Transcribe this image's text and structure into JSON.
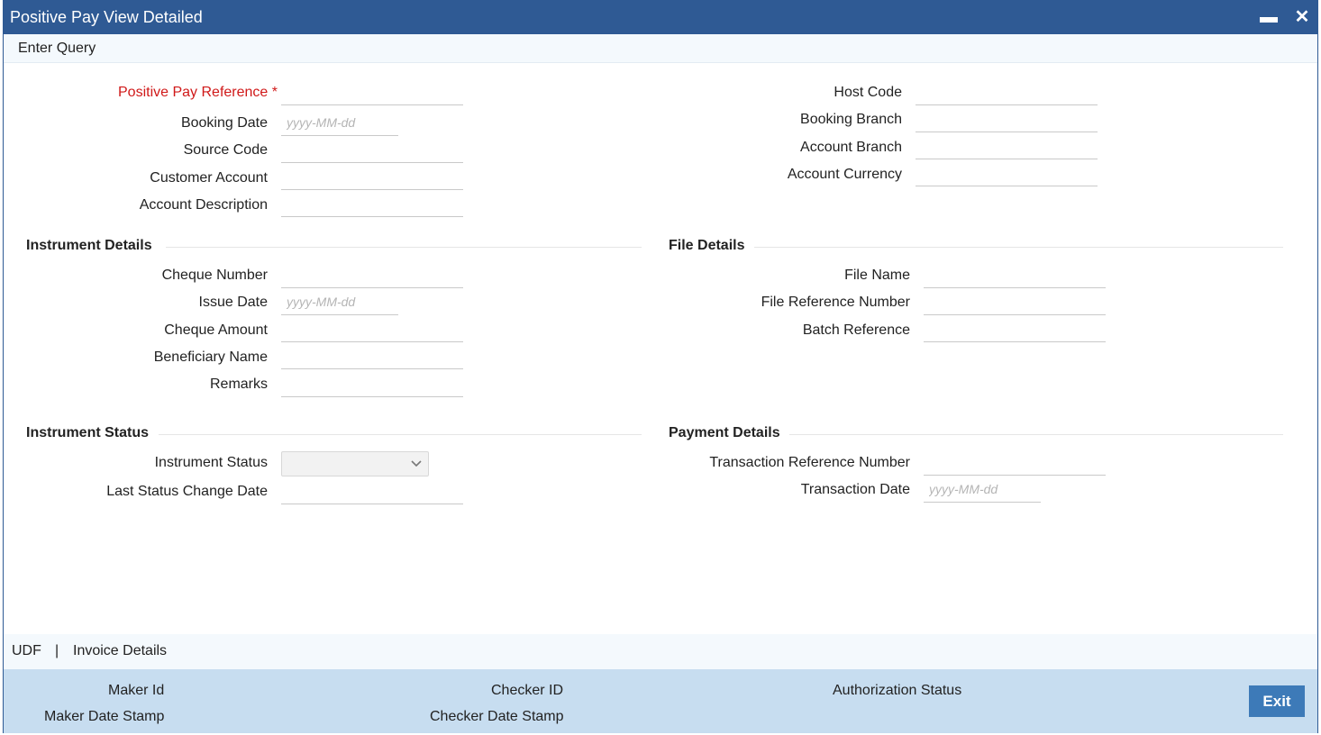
{
  "window": {
    "title": "Positive Pay View Detailed",
    "minimize_glyph": "▬",
    "close_glyph": "✕"
  },
  "menu": {
    "enter_query": "Enter Query"
  },
  "main": {
    "positive_pay_reference": "Positive Pay Reference",
    "required_marker": "*",
    "booking_date": "Booking Date",
    "source_code": "Source Code",
    "customer_account": "Customer Account",
    "account_description": "Account Description",
    "host_code": "Host Code",
    "booking_branch": "Booking Branch",
    "account_branch": "Account Branch",
    "account_currency": "Account Currency",
    "date_placeholder": "yyyy-MM-dd"
  },
  "instrument_details": {
    "header": "Instrument Details",
    "cheque_number": "Cheque Number",
    "issue_date": "Issue Date",
    "cheque_amount": "Cheque Amount",
    "beneficiary_name": "Beneficiary Name",
    "remarks": "Remarks"
  },
  "file_details": {
    "header": "File Details",
    "file_name": "File Name",
    "file_reference_number": "File Reference Number",
    "batch_reference": "Batch Reference"
  },
  "instrument_status": {
    "header": "Instrument Status",
    "instrument_status": "Instrument Status",
    "last_status_change_date": "Last Status Change Date"
  },
  "payment_details": {
    "header": "Payment Details",
    "transaction_reference_number": "Transaction Reference Number",
    "transaction_date": "Transaction Date"
  },
  "footer_tabs": {
    "udf": "UDF",
    "separator": "|",
    "invoice_details": "Invoice Details"
  },
  "audit": {
    "maker_id": "Maker Id",
    "maker_date_stamp": "Maker Date Stamp",
    "checker_id": "Checker ID",
    "checker_date_stamp": "Checker Date Stamp",
    "authorization_status": "Authorization Status",
    "exit": "Exit"
  },
  "colors": {
    "titlebar": "#2f5a94",
    "required": "#d01919",
    "audit_bg": "#c7ddf0",
    "exit_button": "#3d7ab8"
  },
  "icons": {
    "dropdown": "chevron-down-icon"
  }
}
